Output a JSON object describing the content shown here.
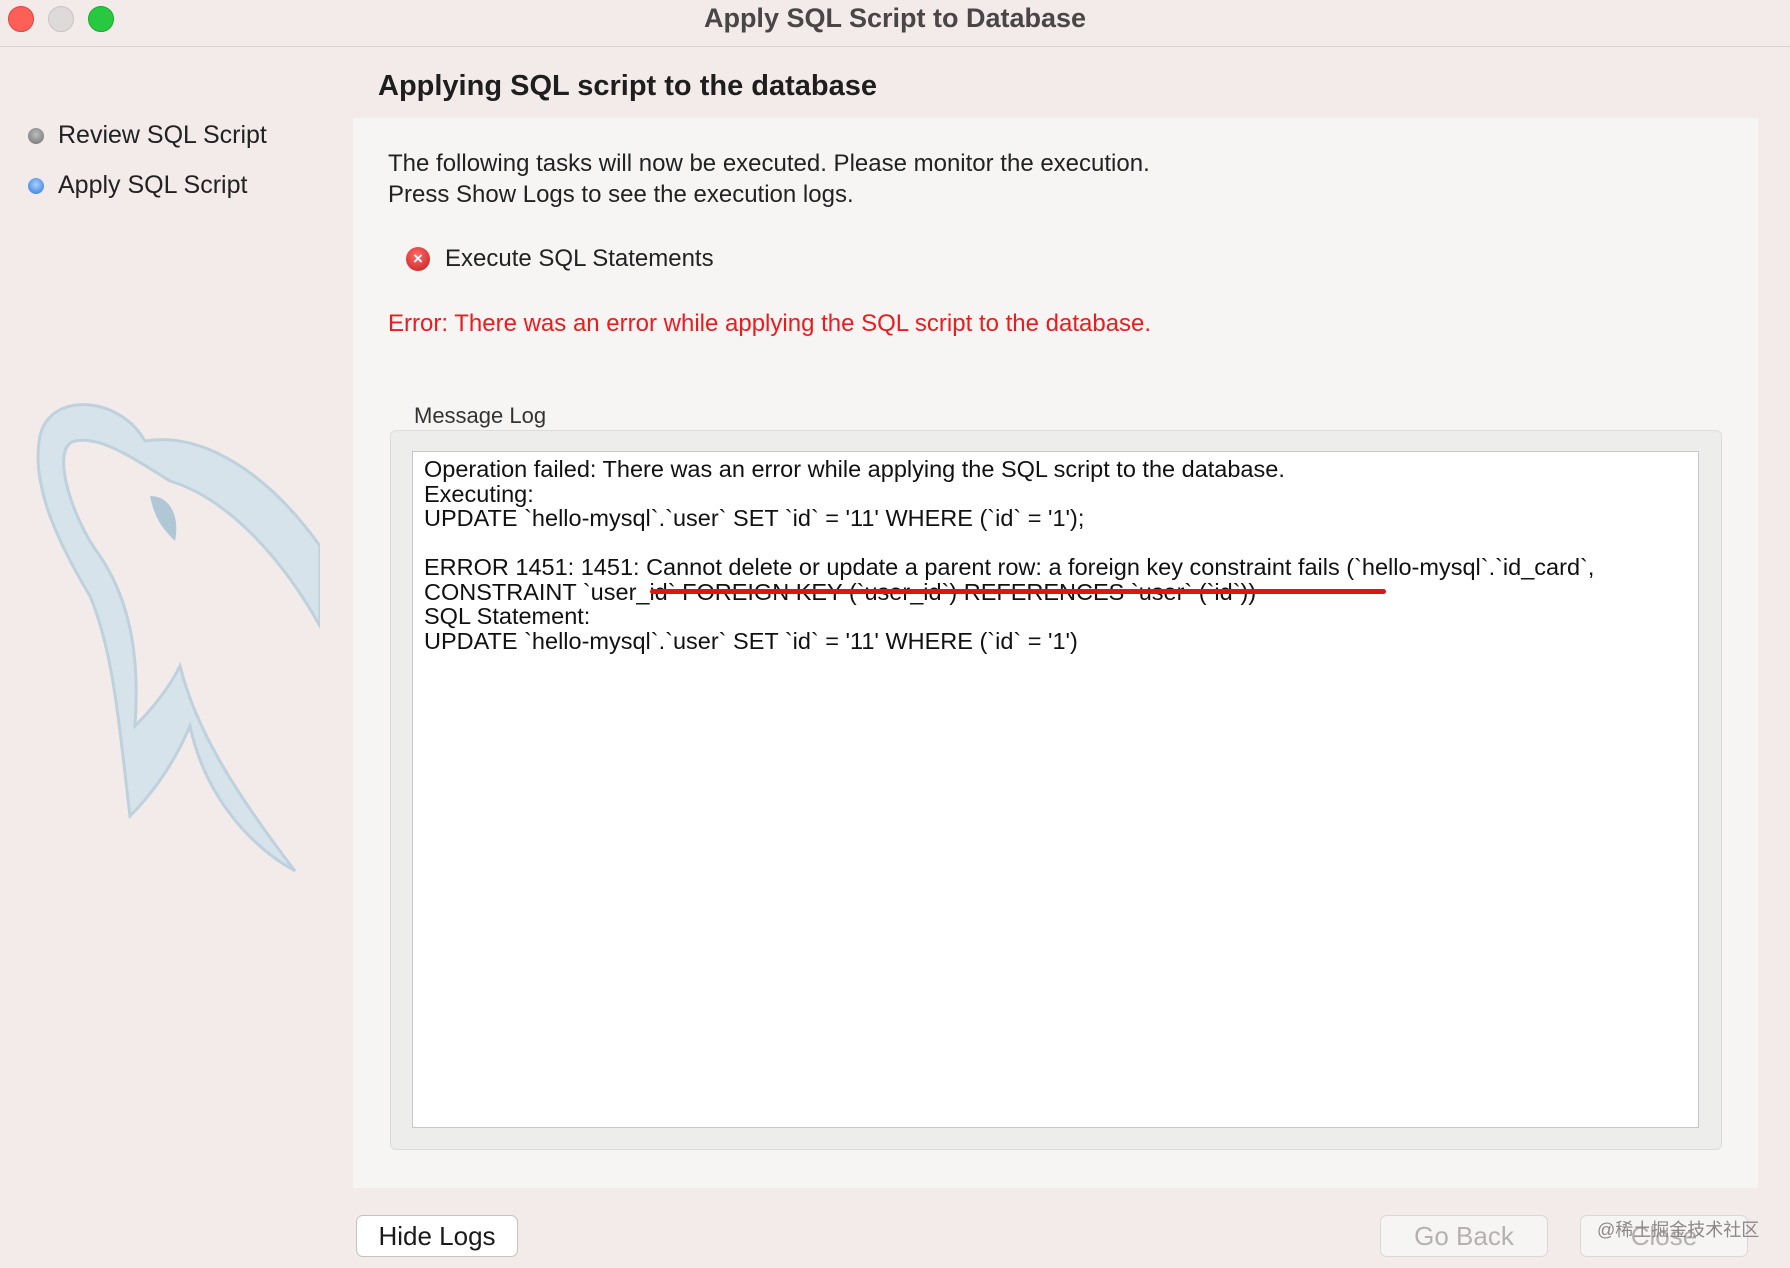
{
  "window": {
    "title": "Apply SQL Script to Database"
  },
  "sidebar": {
    "steps": [
      {
        "label": "Review SQL Script",
        "state": "done"
      },
      {
        "label": "Apply SQL Script",
        "state": "current"
      }
    ]
  },
  "main": {
    "heading": "Applying SQL script to the database",
    "intro_line1": "The following tasks will now be executed. Please monitor the execution.",
    "intro_line2": "Press Show Logs to see the execution logs.",
    "task": {
      "label": "Execute SQL Statements",
      "status": "error"
    },
    "error_message": "Error: There was an error while applying the SQL script to the database.",
    "log": {
      "label": "Message Log",
      "lines": [
        "Operation failed: There was an error while applying the SQL script to the database.",
        "Executing:",
        "UPDATE `hello-mysql`.`user` SET `id` = '11' WHERE (`id` = '1');",
        "",
        "ERROR 1451: 1451: Cannot delete or update a parent row: a foreign key constraint fails (`hello-mysql`.`id_card`,",
        "CONSTRAINT `user_id` FOREIGN KEY (`user_id`) REFERENCES `user` (`id`))",
        "SQL Statement:",
        "UPDATE `hello-mysql`.`user` SET `id` = '11' WHERE (`id` = '1')"
      ]
    }
  },
  "buttons": {
    "hide_logs": "Hide Logs",
    "go_back": "Go Back",
    "close": "Close"
  },
  "watermark": "@稀土掘金技术社区",
  "colors": {
    "error_text": "#ec1c1c",
    "highlight_underline": "#e3140f",
    "step_current": "#2a74d6"
  }
}
